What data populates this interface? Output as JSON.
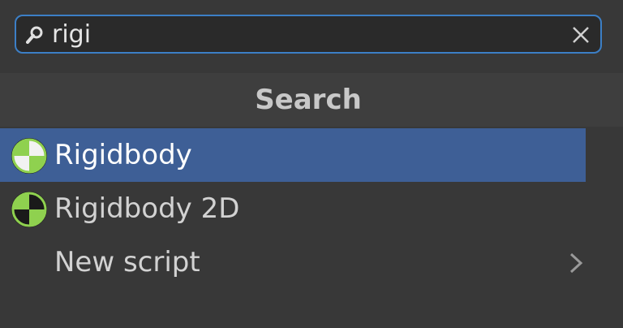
{
  "search": {
    "value": "rigi",
    "placeholder": ""
  },
  "header": {
    "title": "Search"
  },
  "results": [
    {
      "label": "Rigidbody",
      "icon": "rigidbody-icon",
      "selected": true
    },
    {
      "label": "Rigidbody 2D",
      "icon": "rigidbody-2d-icon",
      "selected": false
    },
    {
      "label": "New script",
      "icon": "chevron-right-icon",
      "selected": false
    }
  ],
  "colors": {
    "accent": "#3c7fc6",
    "selection": "#3e5f96",
    "icon_green": "#8fd14f"
  }
}
